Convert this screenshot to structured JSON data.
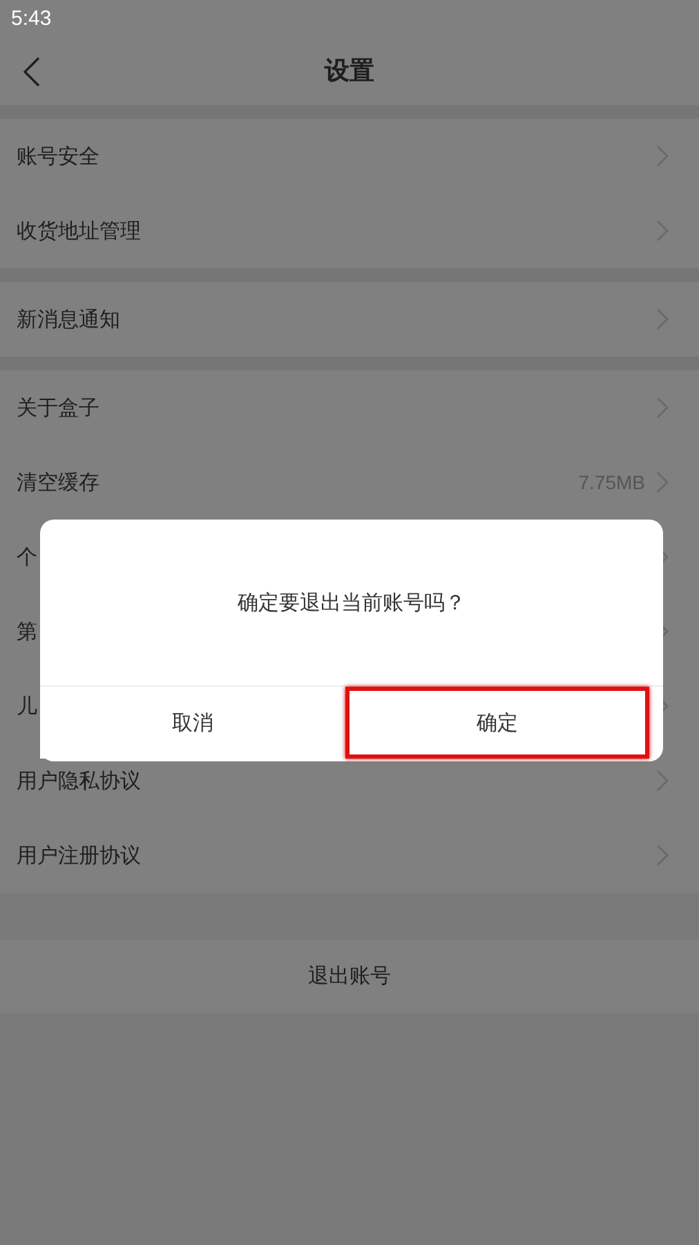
{
  "status_bar": {
    "time": "5:43"
  },
  "header": {
    "title": "设置"
  },
  "sections": [
    {
      "rows": [
        {
          "label": "账号安全"
        },
        {
          "label": "收货地址管理"
        }
      ]
    },
    {
      "rows": [
        {
          "label": "新消息通知"
        }
      ]
    },
    {
      "rows": [
        {
          "label": "关于盒子"
        },
        {
          "label": "清空缓存",
          "value": "7.75MB"
        },
        {
          "label": "个"
        },
        {
          "label": "第"
        },
        {
          "label": "儿"
        },
        {
          "label": "用户隐私协议"
        },
        {
          "label": "用户注册协议"
        }
      ]
    }
  ],
  "logout_button": {
    "label": "退出账号"
  },
  "dialog": {
    "message": "确定要退出当前账号吗？",
    "buttons": [
      {
        "label": "取消",
        "highlighted": false
      },
      {
        "label": "确定",
        "highlighted": true
      }
    ]
  }
}
